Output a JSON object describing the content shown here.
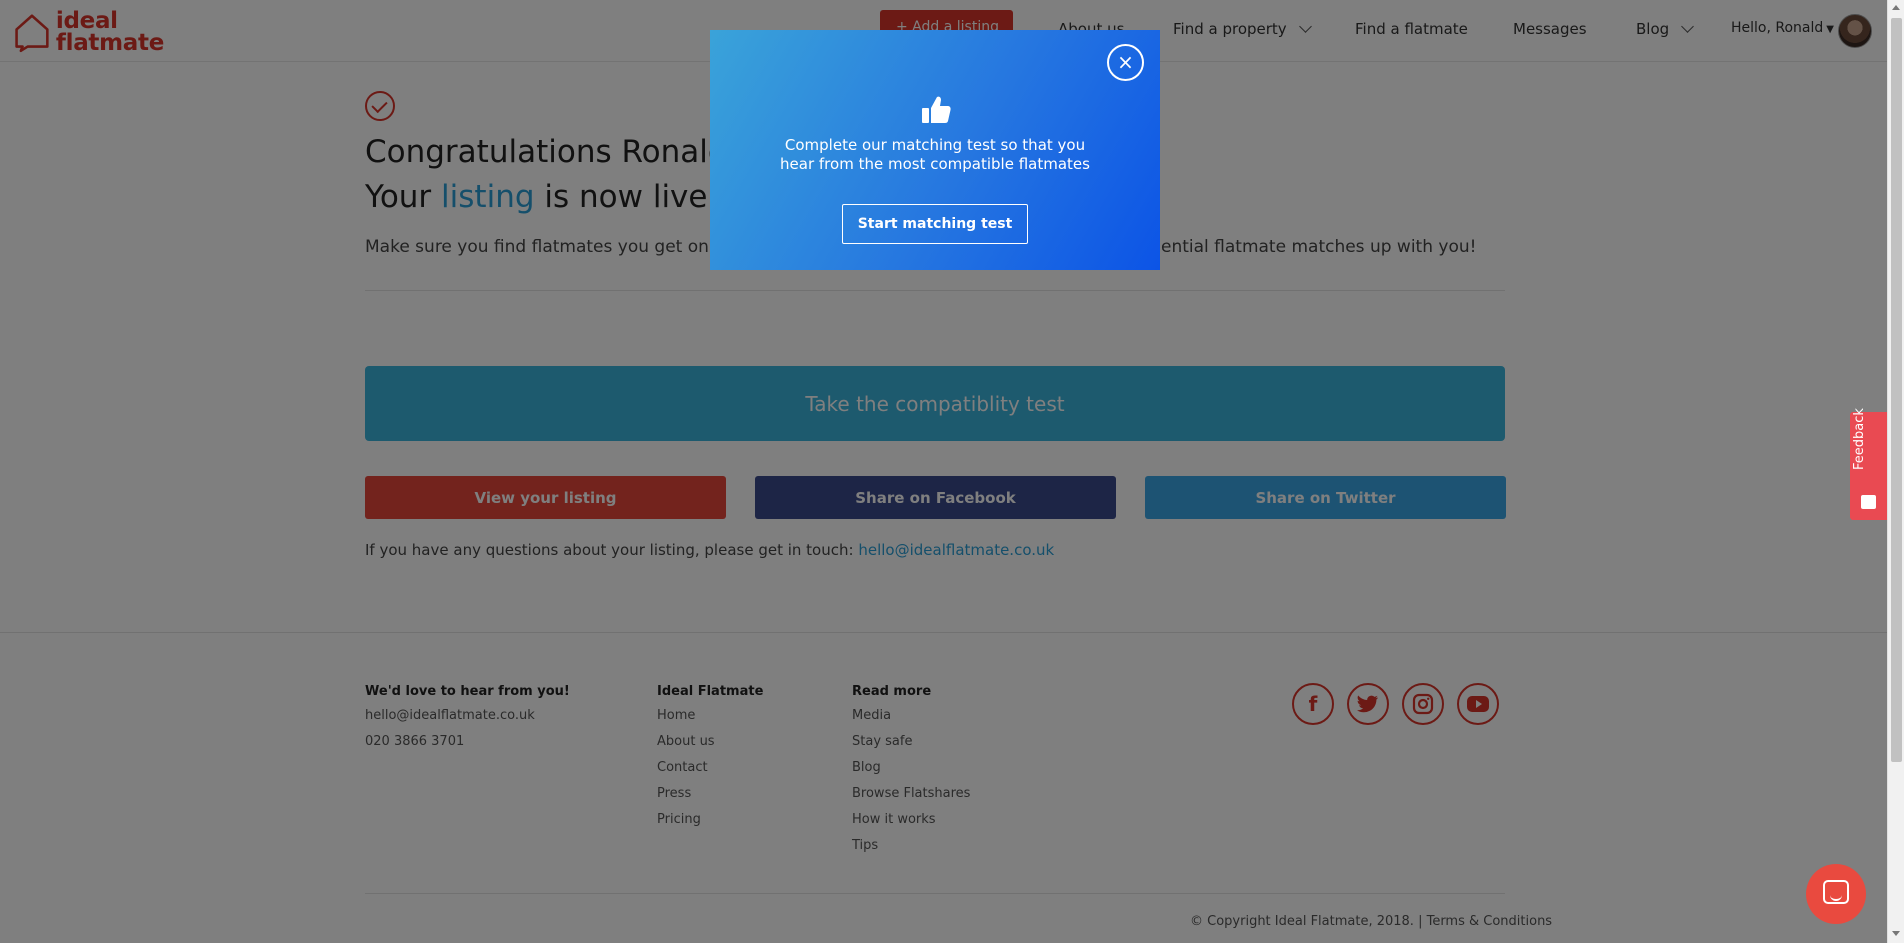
{
  "brand": {
    "logo_line1": "ideal",
    "logo_line2": "flatmate",
    "accent_color": "#d9352b",
    "link_color": "#2a9fd6"
  },
  "header": {
    "add_listing": "+ Add a listing",
    "nav": {
      "about": "About us",
      "find_property": "Find a property",
      "find_flatmate": "Find a flatmate",
      "messages": "Messages",
      "blog": "Blog",
      "user_greeting": "Hello, Ronald"
    }
  },
  "main": {
    "congrats": "Congratulations Ronald!",
    "live_prefix": "Your",
    "live_link": "listing",
    "live_suffix": "is now live!",
    "make_sure_left": "Make sure you find flatmates you get on wit",
    "make_sure_right": "ential flatmate matches up with you!",
    "compat_button": "Take the compatiblity test",
    "view_listing": "View your listing",
    "share_facebook": "Share on Facebook",
    "share_twitter": "Share on Twitter",
    "questions_text": "If you have any questions about your listing, please get in touch:",
    "questions_email": "hello@idealflatmate.co.uk"
  },
  "modal": {
    "text_line1": "Complete our matching test so that you",
    "text_line2": "hear from the most compatible flatmates",
    "button": "Start matching test",
    "close": "×"
  },
  "footer": {
    "contact_head": "We'd love to hear from you!",
    "contact_email": "hello@idealflatmate.co.uk",
    "contact_phone": "020 3866 3701",
    "ideal_head": "Ideal Flatmate",
    "ideal_links": [
      "Home",
      "About us",
      "Contact",
      "Press",
      "Pricing"
    ],
    "read_head": "Read more",
    "read_links": [
      "Media",
      "Stay safe",
      "Blog",
      "Browse Flatshares",
      "How it works",
      "Tips"
    ],
    "social": [
      "facebook-icon",
      "twitter-icon",
      "instagram-icon",
      "youtube-icon"
    ],
    "copyright": "© Copyright Ideal Flatmate, 2018. | Terms & Conditions"
  },
  "feedback": {
    "label": "Feedback"
  }
}
